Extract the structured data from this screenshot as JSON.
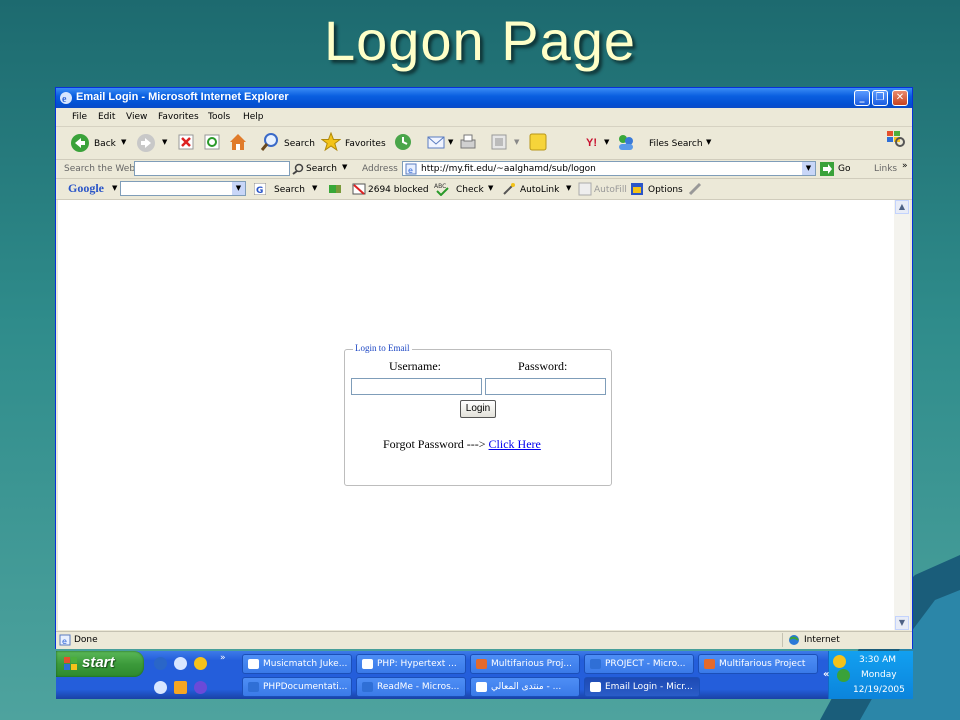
{
  "slide": {
    "title": "Logon Page"
  },
  "window": {
    "title": "Email Login - Microsoft Internet Explorer",
    "min_label": "_",
    "max_label": "❐",
    "close_label": "✕"
  },
  "menu": [
    "File",
    "Edit",
    "View",
    "Favorites",
    "Tools",
    "Help"
  ],
  "toolbar": {
    "back": "Back",
    "search": "Search",
    "favorites": "Favorites",
    "files_search": "Files Search"
  },
  "addressbar": {
    "search_web": "Search the Web",
    "search_btn": "Search",
    "address_label": "Address",
    "url": "http://my.fit.edu/~aalghamd/sub/logon",
    "go": "Go",
    "links": "Links"
  },
  "googlebar": {
    "google": "Google",
    "search": "Search",
    "blocked": "2694 blocked",
    "check": "Check",
    "autolink": "AutoLink",
    "autofill": "AutoFill",
    "options": "Options"
  },
  "login": {
    "legend": "Login to Email",
    "username_label": "Username:",
    "password_label": "Password:",
    "username_value": "",
    "password_value": "",
    "login_button": "Login",
    "forgot_text": "Forgot Password --->",
    "click_here": "Click Here"
  },
  "status": {
    "done": "Done",
    "zone": "Internet"
  },
  "taskbar": {
    "start": "start",
    "row1": [
      "Musicmatch Juke...",
      "PHP: Hypertext ...",
      "Multifarious Proj...",
      "PROJECT - Micro...",
      "Multifarious Project"
    ],
    "row2": [
      "PHPDocumentati...",
      "ReadMe - Micros...",
      "منتدى المعالي - ...",
      "Email Login - Micr..."
    ],
    "clock_time": "3:30 AM",
    "clock_day": "Monday",
    "clock_date": "12/19/2005"
  },
  "colors": {
    "titlebar": "#0a5fe0",
    "link": "#0000ee",
    "legend": "#1c46c4",
    "slide_title": "#ffffc8"
  }
}
